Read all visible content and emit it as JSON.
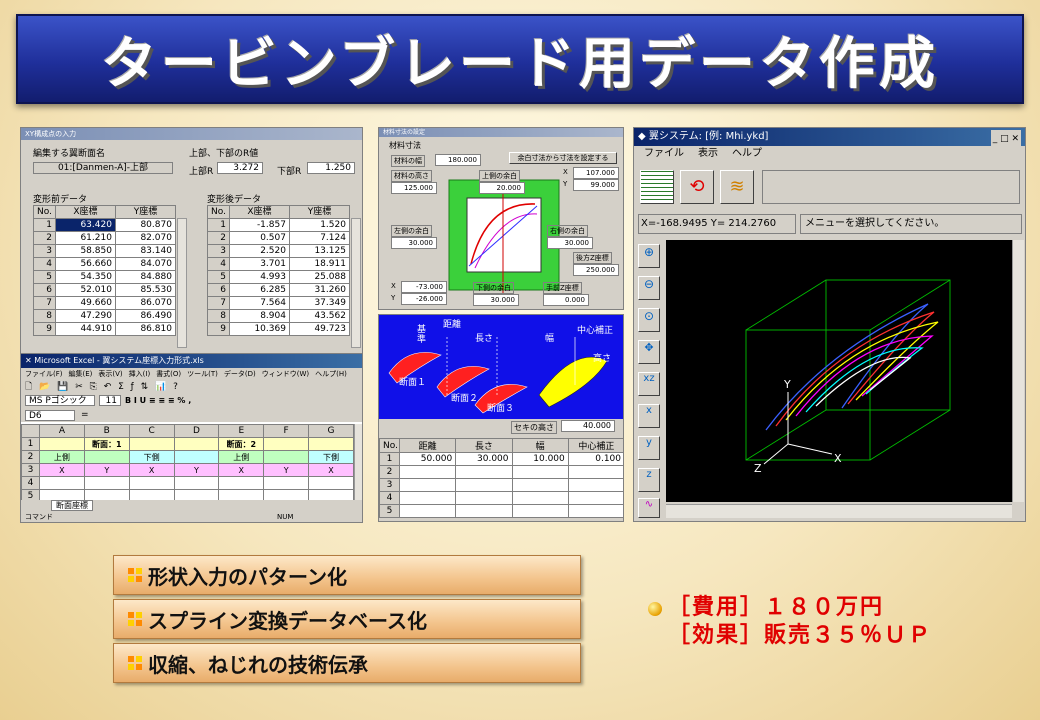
{
  "title": "タービンブレード用データ作成",
  "xy_window": {
    "title": "XY構成点の入力",
    "section_label": "編集する翼断面名",
    "section_value": "01:[Danmen-A]-上部",
    "r_label": "上部、下部のR値",
    "upper_r_label": "上部R",
    "upper_r_value": "3.272",
    "lower_r_label": "下部R",
    "lower_r_value": "1.250",
    "before_label": "変形前データ",
    "after_label": "変形後データ",
    "col_no": "No.",
    "col_x": "X座標",
    "col_y": "Y座標",
    "before_rows": [
      [
        "1",
        "63.420",
        "80.870"
      ],
      [
        "2",
        "61.210",
        "82.070"
      ],
      [
        "3",
        "58.850",
        "83.140"
      ],
      [
        "4",
        "56.660",
        "84.070"
      ],
      [
        "5",
        "54.350",
        "84.880"
      ],
      [
        "6",
        "52.010",
        "85.530"
      ],
      [
        "7",
        "49.660",
        "86.070"
      ],
      [
        "8",
        "47.290",
        "86.490"
      ],
      [
        "9",
        "44.910",
        "86.810"
      ]
    ],
    "after_rows": [
      [
        "1",
        "-1.857",
        "1.520"
      ],
      [
        "2",
        "0.507",
        "7.124"
      ],
      [
        "3",
        "2.520",
        "13.125"
      ],
      [
        "4",
        "3.701",
        "18.911"
      ],
      [
        "5",
        "4.993",
        "25.088"
      ],
      [
        "6",
        "6.285",
        "31.260"
      ],
      [
        "7",
        "7.564",
        "37.349"
      ],
      [
        "8",
        "8.904",
        "43.562"
      ],
      [
        "9",
        "10.369",
        "49.723"
      ]
    ]
  },
  "excel": {
    "title": "Microsoft Excel - 翼システム座標入力形式.xls",
    "menu": [
      "ファイル(F)",
      "編集(E)",
      "表示(V)",
      "挿入(I)",
      "書式(O)",
      "ツール(T)",
      "データ(D)",
      "ウィンドウ(W)",
      "ヘルプ(H)"
    ],
    "font_name": "MS Pゴシック",
    "font_size": "11",
    "name_box": "D6",
    "cols": [
      "A",
      "B",
      "C",
      "D",
      "E",
      "F",
      "G"
    ],
    "section1": "断面：1",
    "section2": "断面：2",
    "upper": "上側",
    "lower": "下側",
    "x": "X",
    "y": "Y",
    "rows": [
      "1",
      "2",
      "3",
      "4",
      "5",
      "6"
    ],
    "sheet_tab": "断面座標",
    "status_left": "コマンド",
    "status_num": "NUM"
  },
  "material": {
    "title": "材料寸法の設定",
    "section": "材料寸法",
    "width_label": "材料の幅",
    "width_value": "180.000",
    "set_button": "余白寸法から寸法を設定する",
    "height_label": "材料の高さ",
    "height_value": "125.000",
    "top_margin_label": "上側の余白",
    "top_margin_value": "20.000",
    "x_label": "X",
    "y_label": "Y",
    "x_value": "107.000",
    "y_value": "99.000",
    "left_margin_label": "左側の余白",
    "left_margin_value": "30.000",
    "right_margin_label": "右側の余白",
    "right_margin_value": "30.000",
    "back_z_label": "後方Z座標",
    "back_z_value": "250.000",
    "x2_value": "-73.000",
    "y2_value": "-26.000",
    "bottom_margin_label": "下側の余白",
    "bottom_margin_value": "30.000",
    "front_z_label": "手前Z座標",
    "front_z_value": "0.000"
  },
  "param": {
    "kyori": "距離",
    "kijun": "基準",
    "nagasa": "長さ",
    "haba": "幅",
    "chushin": "中心補正",
    "takasa": "高さ",
    "dan1": "断面１",
    "dan2": "断面２",
    "dan3": "断面３",
    "seki_label": "セキの高さ",
    "seki_value": "40.000",
    "table_headers": [
      "No.",
      "距離",
      "長さ",
      "幅",
      "中心補正"
    ],
    "table_rows": [
      [
        "1",
        "50.000",
        "30.000",
        "10.000",
        "0.100"
      ],
      [
        "2",
        "",
        "",
        "",
        ""
      ],
      [
        "3",
        "",
        "",
        "",
        ""
      ],
      [
        "4",
        "",
        "",
        "",
        ""
      ],
      [
        "5",
        "",
        "",
        "",
        ""
      ]
    ]
  },
  "wing": {
    "title": "翼システム: [例: Mhi.ykd]",
    "menu": [
      "ファイル",
      "表示",
      "ヘルプ"
    ],
    "coords": "X=-168.9495 Y= 214.2760",
    "message": "メニューを選択してください。",
    "axis_x": "X",
    "axis_y": "Y",
    "axis_z": "Z"
  },
  "bullets": [
    "形状入力のパターン化",
    "スプライン変換データベース化",
    "収縮、ねじれの技術伝承"
  ],
  "cost_line": "［費用］１８０万円",
  "effect_line": "［効果］販売３５％ＵＰ",
  "colors": {
    "banner": "#1f2f9a",
    "bullet_accent": "#e00000"
  }
}
